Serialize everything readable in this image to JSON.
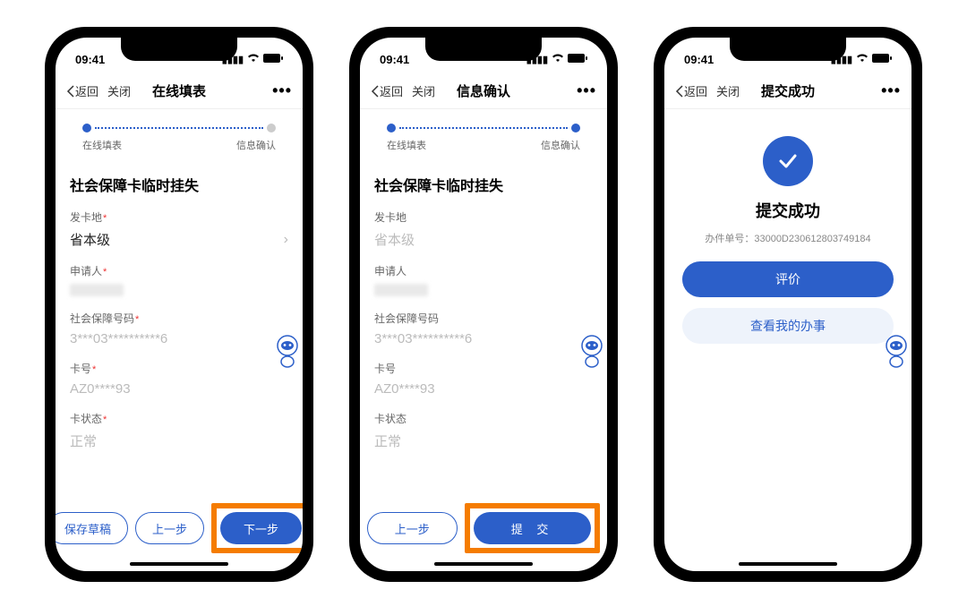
{
  "statusbar": {
    "time": "09:41"
  },
  "nav": {
    "back": "返回",
    "close": "关闭",
    "more": "•••",
    "title1": "在线填表",
    "title2": "信息确认",
    "title3": "提交成功"
  },
  "progress": {
    "step1": "在线填表",
    "step2": "信息确认"
  },
  "section_title": "社会保障卡临时挂失",
  "fields": {
    "issuer_label": "发卡地",
    "issuer_value": "省本级",
    "applicant_label": "申请人",
    "ssn_label": "社会保障号码",
    "ssn_value": "3***03**********6",
    "card_label": "卡号",
    "card_value": "AZ0****93",
    "status_label": "卡状态",
    "status_value": "正常"
  },
  "buttons": {
    "save_draft": "保存草稿",
    "prev": "上一步",
    "next": "下一步",
    "submit": "提 交",
    "rate": "评价",
    "view_mine": "查看我的办事"
  },
  "success": {
    "title": "提交成功",
    "case_label": "办件单号：",
    "case_no": "33000D230612803749184"
  }
}
